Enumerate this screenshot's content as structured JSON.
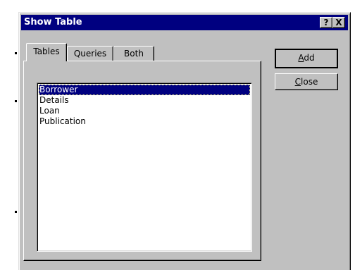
{
  "window": {
    "title": "Show Table",
    "help_glyph": "?",
    "close_glyph": "X"
  },
  "tabs": [
    {
      "label": "Tables",
      "active": true
    },
    {
      "label": "Queries",
      "active": false
    },
    {
      "label": "Both",
      "active": false
    }
  ],
  "list": {
    "items": [
      "Borrower",
      "Details",
      "Loan",
      "Publication"
    ],
    "selected": "Borrower"
  },
  "buttons": {
    "add": {
      "mnemonic": "A",
      "rest": "dd"
    },
    "close": {
      "mnemonic": "C",
      "rest": "lose"
    }
  },
  "colors": {
    "titlebar": "#000080",
    "face": "#c0c0c0",
    "selection": "#000080"
  }
}
